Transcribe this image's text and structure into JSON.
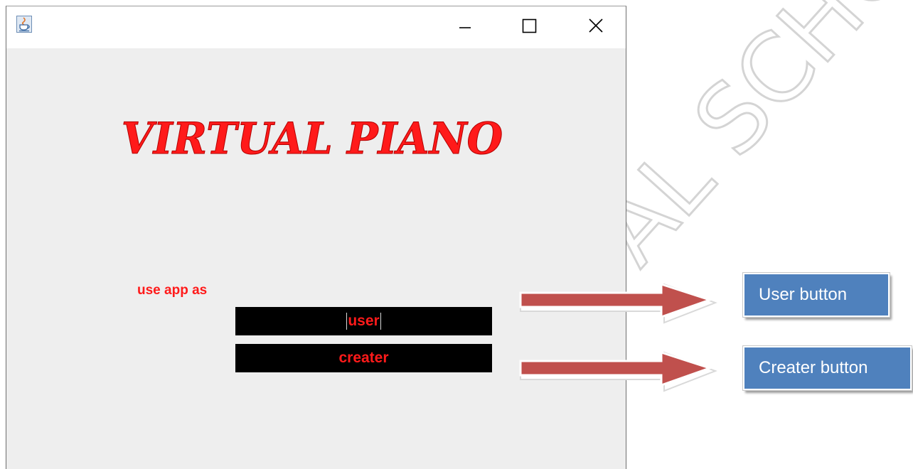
{
  "window": {
    "app_icon": "java-coffee-icon",
    "controls": [
      "minimize-icon",
      "maximize-icon",
      "close-icon"
    ]
  },
  "main": {
    "title": "VIRTUAL PIANO",
    "use_app_label": "use app as",
    "user_button_label": "user",
    "creater_button_label": "creater"
  },
  "annotations": {
    "user_callout": "User button",
    "creater_callout": "Creater button"
  },
  "watermark": {
    "visible_text": "AL SCHOOL"
  },
  "colors": {
    "window_background": "#eeeeee",
    "accent_red": "#ff1a1a",
    "button_background": "#000000",
    "callout_blue": "#4f81bd",
    "arrow_red": "#c0504d"
  }
}
